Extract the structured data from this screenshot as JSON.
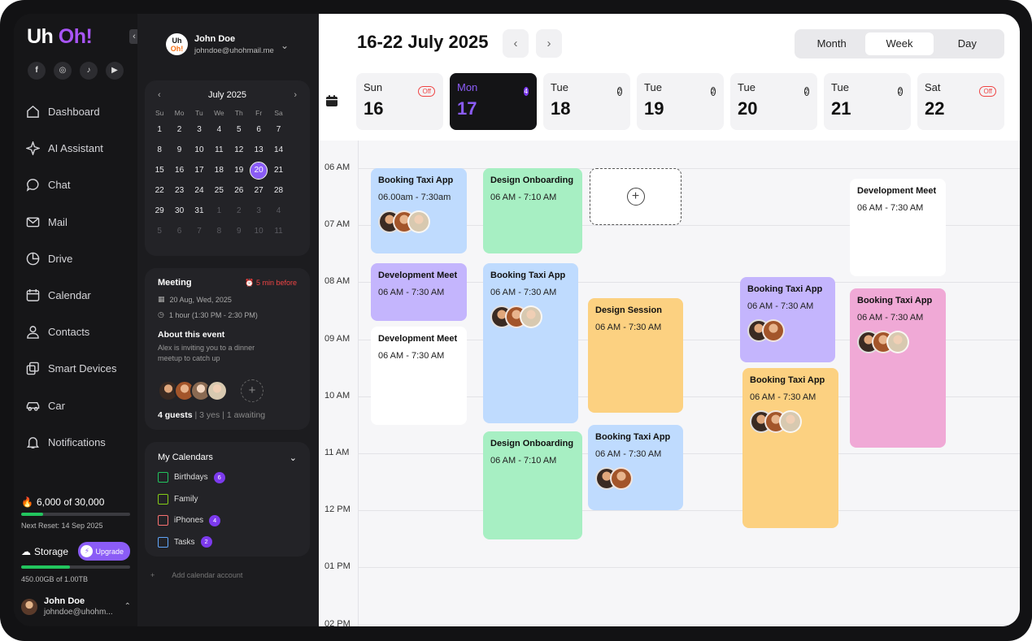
{
  "app": {
    "logo_uh": "Uh",
    "logo_oh": "Oh!"
  },
  "socials": [
    "f",
    "◎",
    "♪",
    "▶"
  ],
  "nav": [
    {
      "label": "Dashboard",
      "icon": "home-icon"
    },
    {
      "label": "AI Assistant",
      "icon": "sparkle-icon"
    },
    {
      "label": "Chat",
      "icon": "chat-bubble-icon"
    },
    {
      "label": "Mail",
      "icon": "mail-icon"
    },
    {
      "label": "Drive",
      "icon": "pie-chart-icon"
    },
    {
      "label": "Calendar",
      "icon": "calendar-icon"
    },
    {
      "label": "Contacts",
      "icon": "person-icon"
    },
    {
      "label": "Smart Devices",
      "icon": "devices-icon"
    },
    {
      "label": "Car",
      "icon": "car-icon"
    },
    {
      "label": "Notifications",
      "icon": "bell-icon"
    }
  ],
  "credits": {
    "label": "6,000 of 30,000",
    "fraction": 0.2,
    "reset": "Next Reset: 14 Sep 2025"
  },
  "storage": {
    "label": "Storage",
    "upgrade": "Upgrade",
    "amount": "450.00GB of 1.00TB",
    "fraction": 0.45
  },
  "footer_user": {
    "name": "John Doe",
    "email": "johndoe@uhohm..."
  },
  "profile": {
    "avatar_top": "Uh",
    "avatar_bottom": "Oh!",
    "name": "John Doe",
    "email": "johndoe@uhohmail.me"
  },
  "mini_calendar": {
    "month": "July 2025",
    "weekdays": [
      "Su",
      "Mo",
      "Tu",
      "We",
      "Th",
      "Fr",
      "Sa"
    ],
    "weeks": [
      [
        "1",
        "2",
        "3",
        "4",
        "5",
        "6",
        "7"
      ],
      [
        "8",
        "9",
        "10",
        "11",
        "12",
        "13",
        "14"
      ],
      [
        "15",
        "16",
        "17",
        "18",
        "19",
        "20",
        "21"
      ],
      [
        "22",
        "23",
        "24",
        "25",
        "26",
        "27",
        "28"
      ],
      [
        "29",
        "30",
        "31",
        "1",
        "2",
        "3",
        "4"
      ],
      [
        "5",
        "6",
        "7",
        "8",
        "9",
        "10",
        "11"
      ]
    ],
    "selected": "20"
  },
  "meeting": {
    "title": "Meeting",
    "reminder": "5 min before",
    "date": "20 Aug, Wed, 2025",
    "duration": "1 hour (1:30 PM - 2:30 PM)",
    "about_title": "About this event",
    "about_text": "Alex is inviting you to a dinner meetup to catch up",
    "guests_count": "4 guests",
    "guests_yes": "3 yes",
    "guests_awaiting": "1 awaiting"
  },
  "my_calendars": {
    "title": "My Calendars",
    "items": [
      {
        "label": "Birthdays",
        "badge": "6",
        "color": "#22c55e"
      },
      {
        "label": "Family",
        "badge": "",
        "color": "#84cc16"
      },
      {
        "label": "iPhones",
        "badge": "4",
        "color": "#f87171"
      },
      {
        "label": "Tasks",
        "badge": "2",
        "color": "#60a5fa"
      }
    ],
    "add_account": "Add calendar account"
  },
  "header": {
    "range": "16-22 July 2025",
    "views": [
      "Month",
      "Week",
      "Day"
    ],
    "active_view": "Week"
  },
  "days": [
    {
      "name": "Sun",
      "date": "16",
      "badge": "Off",
      "badge_type": "off"
    },
    {
      "name": "Mon",
      "date": "17",
      "badge": "4",
      "badge_type": "count",
      "active": true
    },
    {
      "name": "Tue",
      "date": "18",
      "badge": "2",
      "badge_type": "count"
    },
    {
      "name": "Tue",
      "date": "19",
      "badge": "2",
      "badge_type": "count"
    },
    {
      "name": "Tue",
      "date": "20",
      "badge": "2",
      "badge_type": "count"
    },
    {
      "name": "Tue",
      "date": "21",
      "badge": "2",
      "badge_type": "count"
    },
    {
      "name": "Sat",
      "date": "22",
      "badge": "Off",
      "badge_type": "off"
    }
  ],
  "hours": [
    "06 AM",
    "07 AM",
    "08 AM",
    "09 AM",
    "10 AM",
    "11 AM",
    "12 PM",
    "01 PM",
    "02 PM"
  ],
  "events": [
    {
      "title": "Booking Taxi App",
      "time": "06.00am - 7:30am",
      "color": "blue",
      "guests": [
        "f1",
        "f2",
        "f3"
      ]
    },
    {
      "title": "Development Meet",
      "time": "06 AM - 7:30 AM",
      "color": "purple",
      "guests": []
    },
    {
      "title": "Development Meet",
      "time": "06 AM - 7:30 AM",
      "color": "white",
      "guests": []
    },
    {
      "title": "Design Onboarding",
      "time": "06 AM - 7:10 AM",
      "color": "green",
      "guests": []
    },
    {
      "title": "Booking Taxi App",
      "time": "06 AM - 7:30 AM",
      "color": "blue",
      "guests": [
        "f1",
        "f2",
        "f3"
      ]
    },
    {
      "title": "Design Onboarding",
      "time": "06 AM - 7:10 AM",
      "color": "green",
      "guests": []
    },
    {
      "title": "Design Session",
      "time": "06 AM - 7:30 AM",
      "color": "orange",
      "guests": []
    },
    {
      "title": "Booking Taxi App",
      "time": "06 AM - 7:30 AM",
      "color": "blue",
      "guests": [
        "f1",
        "f2"
      ]
    },
    {
      "title": "Booking Taxi App",
      "time": "06 AM - 7:30 AM",
      "color": "purple",
      "guests": [
        "f1",
        "f2"
      ]
    },
    {
      "title": "Booking Taxi App",
      "time": "06 AM - 7:30 AM",
      "color": "orange",
      "guests": [
        "f1",
        "f2",
        "f3"
      ]
    },
    {
      "title": "Development Meet",
      "time": "06 AM - 7:30 AM",
      "color": "white",
      "guests": []
    },
    {
      "title": "Booking Taxi App",
      "time": "06 AM - 7:30 AM",
      "color": "pink",
      "guests": [
        "f1",
        "f2",
        "f3"
      ]
    }
  ]
}
